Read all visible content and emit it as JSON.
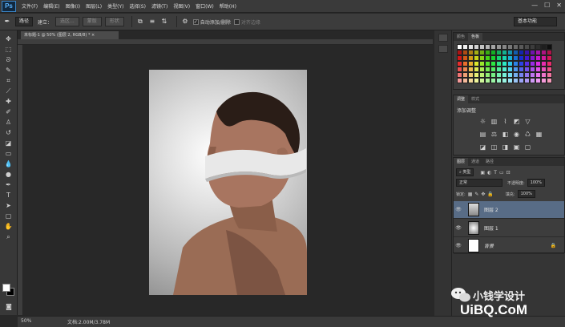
{
  "app": {
    "logo": "Ps",
    "menu": [
      "文件(F)",
      "编辑(E)",
      "图像(I)",
      "图层(L)",
      "类型(Y)",
      "选择(S)",
      "滤镜(T)",
      "视图(V)",
      "窗口(W)",
      "帮助(H)"
    ]
  },
  "options": {
    "tool_mode": "路径",
    "build_label": "建立：",
    "select_btn": "选区...",
    "mask_btn": "蒙版",
    "shape_btn": "形状",
    "auto_add_delete": "自动添加/删除",
    "align_edges": "对齐边缘",
    "workspace": "基本功能"
  },
  "document": {
    "tab_title": "未标题-1 @ 50% (图层 2, RGB/8) *",
    "zoom": "50%",
    "doc_info": "文档:2.00M/3.78M"
  },
  "panels": {
    "color_tabs": [
      "颜色",
      "色板"
    ],
    "adj_tabs": [
      "调整",
      "样式"
    ],
    "adj_title": "添加调整",
    "layers_tabs": [
      "图层",
      "通道",
      "路径"
    ],
    "kind_select": "类型",
    "blend_mode": "正常",
    "opacity_label": "不透明度:",
    "opacity_value": "100%",
    "lock_label": "锁定:",
    "fill_label": "填充:",
    "fill_value": "100%",
    "layers": [
      {
        "name": "图层 2"
      },
      {
        "name": "图层 1"
      },
      {
        "name": "背景"
      }
    ]
  },
  "watermark": {
    "line1": "小钱学设计",
    "line2": "UiBQ.CoM"
  },
  "colors": {
    "selected_layer": "#586c86",
    "panel_bg": "#3d3d3d",
    "workspace_bg": "#282828"
  }
}
